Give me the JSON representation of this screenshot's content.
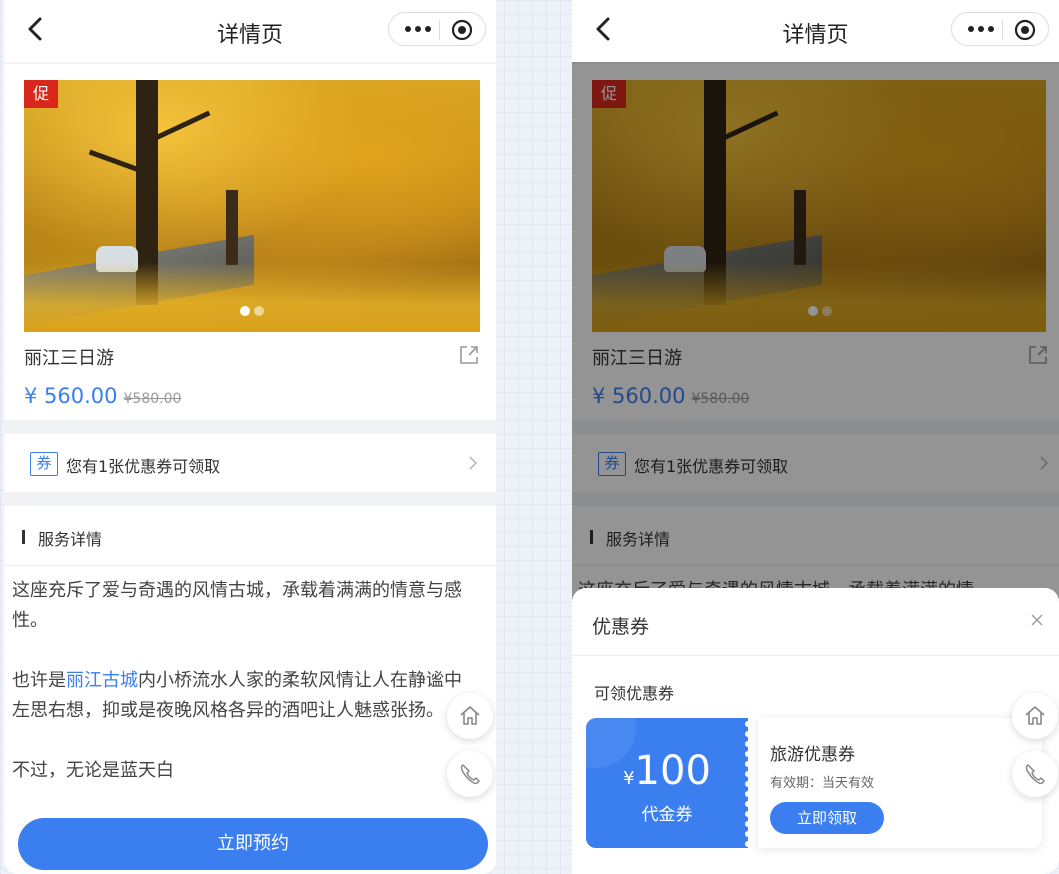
{
  "left": {
    "nav": {
      "title": "详情页"
    },
    "product": {
      "promo_tag": "促",
      "name": "丽江三日游",
      "price_now": "¥ 560.00",
      "price_old": "¥580.00"
    },
    "coupon": {
      "badge": "券",
      "text": "您有1张优惠券可领取"
    },
    "service": {
      "title": "服务详情",
      "p1": "这座充斥了爱与奇遇的风情古城，承载着满满的情意与感性。",
      "p2_pre": "也许是",
      "p2_link": "丽江古城",
      "p2_post": "内小桥流水人家的柔软风情让人在静谧中左思右想，抑或是夜晚风格各异的酒吧让人魅惑张扬。",
      "p3": "不过，无论是蓝天白"
    },
    "book_label": "立即预约"
  },
  "right": {
    "nav": {
      "title": "详情页"
    },
    "product": {
      "promo_tag": "促",
      "name": "丽江三日游",
      "price_now": "¥ 560.00",
      "price_old": "¥580.00"
    },
    "coupon": {
      "badge": "券",
      "text": "您有1张优惠券可领取"
    },
    "service": {
      "title": "服务详情",
      "p1": "这座充斥了爱与奇遇的风情古城，承载着满满的情"
    },
    "sheet": {
      "title": "优惠券",
      "subtitle": "可领优惠券",
      "ticket": {
        "currency": "¥",
        "amount": "100",
        "kind": "代金券",
        "name": "旅游优惠券",
        "validity": "有效期：当天有效",
        "claim_label": "立即领取"
      }
    }
  },
  "colors": {
    "accent": "#3b7ef0",
    "promo": "#d9281b"
  }
}
